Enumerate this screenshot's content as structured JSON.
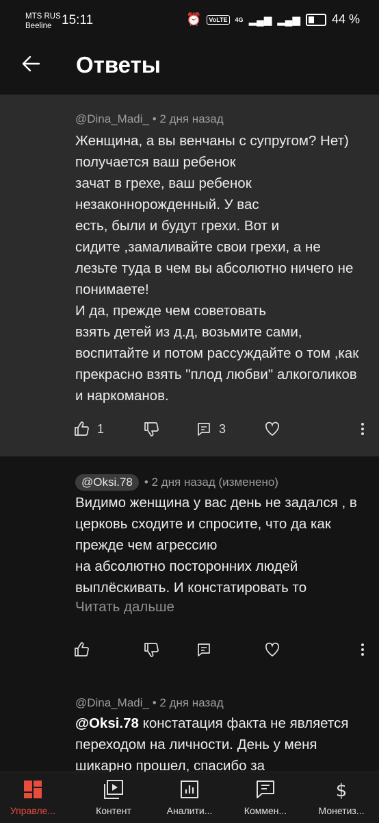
{
  "status": {
    "carrier1": "MTS RUS",
    "carrier2": "Beeline",
    "time": "15:11",
    "volte": "VoLTE",
    "network": "4G",
    "battery": "44 %"
  },
  "header": {
    "title": "Ответы"
  },
  "comments": [
    {
      "author": "@Dina_Madi_",
      "meta": "• 2 дня назад",
      "text": "Женщина, а вы венчаны с супругом? Нет) получается ваш ребенок\nзачат в грехе, ваш ребенок\nнезаконнорожденный. У вас\nесть, были и будут грехи. Вот и\nсидите ,замаливайте свои грехи, а не лезьте туда в чем вы абсолютно ничего не понимаете!\nИ да, прежде чем советовать\nвзять детей из д.д, возьмите сами, воспитайте и потом рассуждайте о том ,как прекрасно взять \"плод любви\" алкоголиков и наркоманов.",
      "likes": "1",
      "replies": "3"
    },
    {
      "author": "@Oksi.78",
      "meta": "• 2 дня назад (изменено)",
      "text": "Видимо женщина у вас день не задался , в церковь сходите и спросите, что да как прежде чем агрессию\nна абсолютно посторонних людей выплёскивать. И констатировать то",
      "read_more": "Читать дальше"
    },
    {
      "author": "@Dina_Madi_",
      "meta": "• 2 дня назад",
      "mention": "@Oksi.78",
      "text": " констатация факта не является переходом на личности. День у меня шикарно прошел, спасибо за"
    }
  ],
  "bottom_nav": [
    {
      "label": "Управле...",
      "icon": "dashboard-icon",
      "active": true
    },
    {
      "label": "Контент",
      "icon": "video-content-icon"
    },
    {
      "label": "Аналити...",
      "icon": "analytics-icon"
    },
    {
      "label": "Коммен...",
      "icon": "comments-icon"
    },
    {
      "label": "Монетиз...",
      "icon": "monetization-icon"
    }
  ],
  "colors": {
    "background": "#141414",
    "highlight": "#2c2c2c",
    "accent": "#e74c3c"
  }
}
